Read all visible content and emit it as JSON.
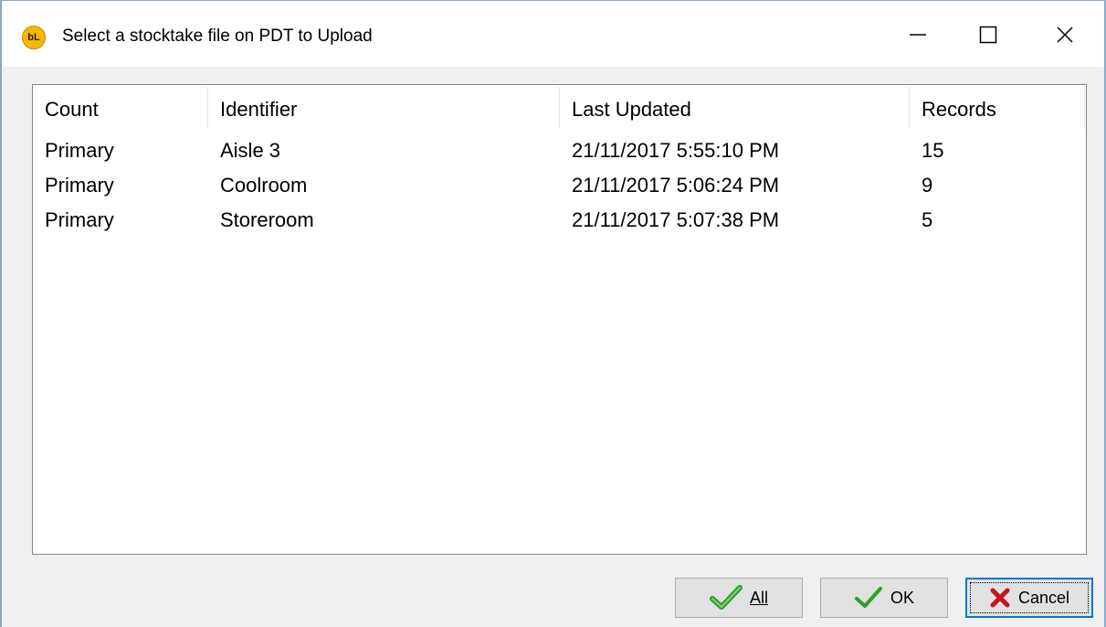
{
  "window": {
    "title": "Select a stocktake file on PDT to Upload",
    "app_icon_text": "bL"
  },
  "list": {
    "columns": [
      "Count",
      "Identifier",
      "Last Updated",
      "Records"
    ],
    "rows": [
      {
        "count": "Primary",
        "identifier": "Aisle 3",
        "last_updated": "21/11/2017 5:55:10 PM",
        "records": "15"
      },
      {
        "count": "Primary",
        "identifier": "Coolroom",
        "last_updated": "21/11/2017 5:06:24 PM",
        "records": "9"
      },
      {
        "count": "Primary",
        "identifier": "Storeroom",
        "last_updated": "21/11/2017 5:07:38 PM",
        "records": "5"
      }
    ]
  },
  "buttons": {
    "all_label": "All",
    "ok_label": "OK",
    "cancel_label": "Cancel"
  },
  "colors": {
    "check_green": "#2e9e2e",
    "cancel_red": "#c4161c",
    "focus_blue": "#0078d7"
  }
}
